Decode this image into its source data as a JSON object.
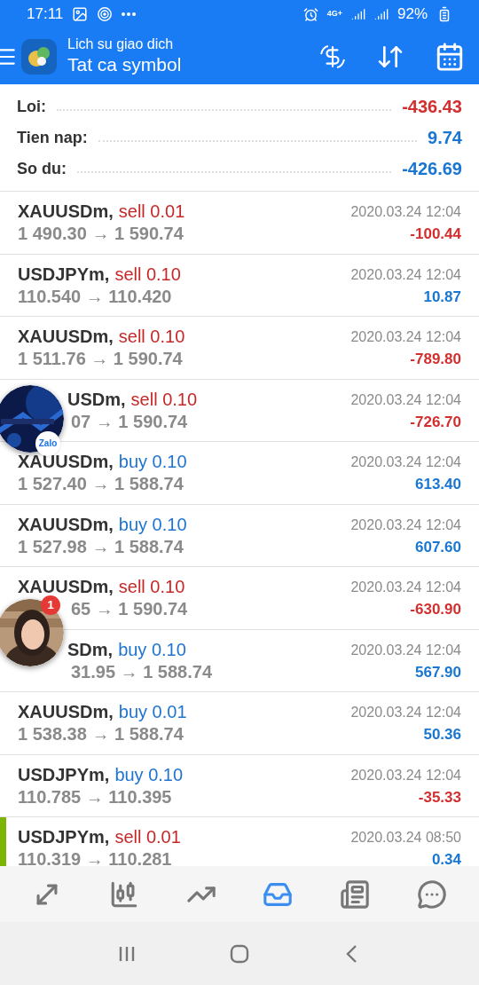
{
  "status_bar": {
    "time": "17:11",
    "network": "4G+",
    "battery": "92%"
  },
  "header": {
    "subtitle": "Lich su giao dich",
    "title": "Tat ca symbol"
  },
  "summary": [
    {
      "label": "Loi:",
      "value": "-436.43",
      "color": "#d32f2f"
    },
    {
      "label": "Tien nap:",
      "value": "9.74",
      "color": "#1976d2"
    },
    {
      "label": "So du:",
      "value": "-426.69",
      "color": "#1976d2"
    }
  ],
  "trades": [
    {
      "symbol": "XAUUSDm,",
      "side": "sell",
      "sell": true,
      "volume": "0.01",
      "price": "1 490.30 → 1 590.74",
      "time": "2020.03.24 12:04",
      "result": "-100.44",
      "loss": true
    },
    {
      "symbol": "USDJPYm,",
      "side": "sell",
      "sell": true,
      "volume": "0.10",
      "price": "110.540 → 110.420",
      "time": "2020.03.24 12:04",
      "result": "10.87",
      "loss": false
    },
    {
      "symbol": "XAUUSDm,",
      "side": "sell",
      "sell": true,
      "volume": "0.10",
      "price": "1 511.76 → 1 590.74",
      "time": "2020.03.24 12:04",
      "result": "-789.80",
      "loss": true
    },
    {
      "symbol": "USDm,",
      "side": "sell",
      "sell": true,
      "volume": "0.10",
      "price": "07 → 1 590.74",
      "time": "2020.03.24 12:04",
      "result": "-726.70",
      "loss": true,
      "symbol_cut": true,
      "price_cut": true,
      "chat_head": {
        "kind": "channel",
        "badge": "Zalo"
      }
    },
    {
      "symbol": "XAUUSDm,",
      "side": "buy",
      "sell": false,
      "volume": "0.10",
      "price": "1 527.40 → 1 588.74",
      "time": "2020.03.24 12:04",
      "result": "613.40",
      "loss": false
    },
    {
      "symbol": "XAUUSDm,",
      "side": "buy",
      "sell": false,
      "volume": "0.10",
      "price": "1 527.98 → 1 588.74",
      "time": "2020.03.24 12:04",
      "result": "607.60",
      "loss": false
    },
    {
      "symbol": "XAUUSDm,",
      "side": "sell",
      "sell": true,
      "volume": "0.10",
      "price": "65 → 1 590.74",
      "time": "2020.03.24 12:04",
      "result": "-630.90",
      "loss": true,
      "price_cut": true,
      "chat_head": {
        "kind": "person",
        "badge": "1"
      }
    },
    {
      "symbol": "SDm,",
      "side": "buy",
      "sell": false,
      "volume": "0.10",
      "price": "31.95 → 1 588.74",
      "time": "2020.03.24 12:04",
      "result": "567.90",
      "loss": false,
      "symbol_cut": true,
      "price_cut": true
    },
    {
      "symbol": "XAUUSDm,",
      "side": "buy",
      "sell": false,
      "volume": "0.01",
      "price": "1 538.38 → 1 588.74",
      "time": "2020.03.24 12:04",
      "result": "50.36",
      "loss": false
    },
    {
      "symbol": "USDJPYm,",
      "side": "buy",
      "sell": false,
      "volume": "0.10",
      "price": "110.785 → 110.395",
      "time": "2020.03.24 12:04",
      "result": "-35.33",
      "loss": true
    },
    {
      "symbol": "USDJPYm,",
      "side": "sell",
      "sell": true,
      "volume": "0.01",
      "price": "110.319 → 110.281",
      "time": "2020.03.24 08:50",
      "result": "0.34",
      "loss": false,
      "color": "#7cb500"
    }
  ],
  "bottom_nav": [
    {
      "kind": "quotes",
      "selected": false
    },
    {
      "kind": "chart",
      "selected": false
    },
    {
      "kind": "trade",
      "selected": false
    },
    {
      "kind": "history",
      "selected": true
    },
    {
      "kind": "news",
      "selected": false
    },
    {
      "kind": "chat",
      "selected": false
    }
  ]
}
